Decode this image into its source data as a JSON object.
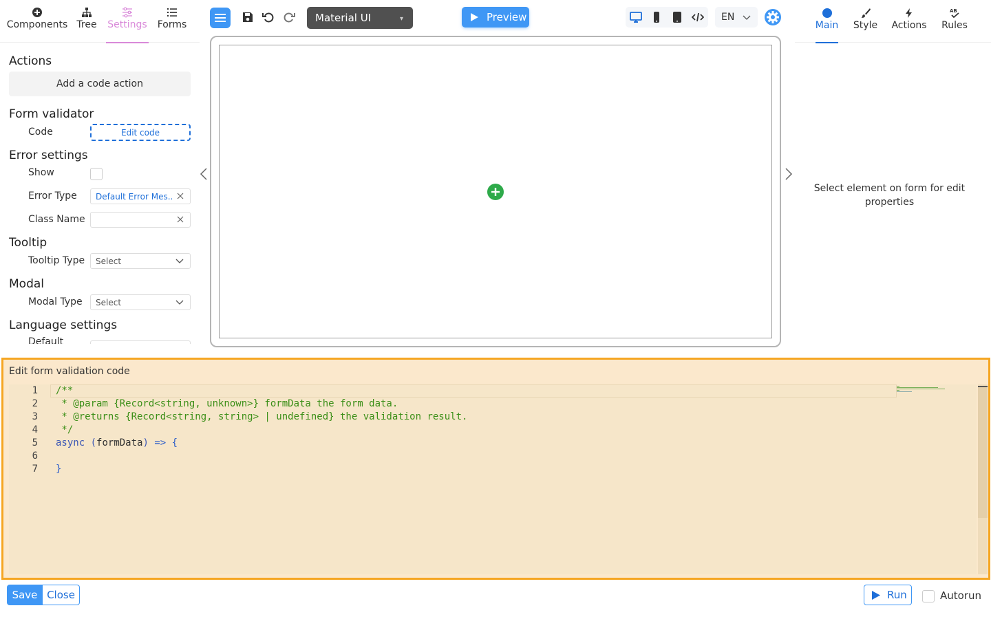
{
  "left_tabs": [
    {
      "label": "Components",
      "icon": "plus-circle-icon"
    },
    {
      "label": "Tree",
      "icon": "sitemap-icon"
    },
    {
      "label": "Settings",
      "icon": "sliders-icon",
      "active": true
    },
    {
      "label": "Forms",
      "icon": "list-icon"
    }
  ],
  "settings": {
    "actions_title": "Actions",
    "add_code_action": "Add a code action",
    "form_validator_title": "Form validator",
    "code_label": "Code",
    "edit_code": "Edit code",
    "error_settings_title": "Error settings",
    "show_label": "Show",
    "error_type_label": "Error Type",
    "error_type_value": "Default Error Mes...",
    "class_name_label": "Class Name",
    "class_name_value": "",
    "tooltip_title": "Tooltip",
    "tooltip_type_label": "Tooltip Type",
    "tooltip_type_placeholder": "Select",
    "modal_title": "Modal",
    "modal_type_label": "Modal Type",
    "modal_type_placeholder": "Select",
    "language_title": "Language settings",
    "default_label": "Default"
  },
  "toolbar": {
    "theme": "Material UI",
    "preview": "Preview",
    "language": "EN"
  },
  "right_tabs": [
    {
      "label": "Main",
      "icon": "circle-icon",
      "active": true
    },
    {
      "label": "Style",
      "icon": "brush-icon"
    },
    {
      "label": "Actions",
      "icon": "bolt-icon"
    },
    {
      "label": "Rules",
      "icon": "spellcheck-icon"
    }
  ],
  "right_panel": {
    "hint": "Select element on form for edit properties"
  },
  "editor": {
    "title": "Edit form validation code",
    "line_numbers": [
      "1",
      "2",
      "3",
      "4",
      "5",
      "6",
      "7"
    ],
    "lines": [
      "/**",
      " * @param {Record<string, unknown>} formData the form data.",
      " * @returns {Record<string, string> | undefined} the validation result.",
      " */",
      "async (formData) => {",
      "",
      "}"
    ]
  },
  "footer": {
    "save": "Save",
    "close": "Close",
    "run": "Run",
    "autorun": "Autorun"
  },
  "colors": {
    "accent": "#3f97f5",
    "settings_active": "#d989d9",
    "editor_border": "#f5a623",
    "editor_bg": "#fbe8cc",
    "comment": "#3c8f18"
  }
}
